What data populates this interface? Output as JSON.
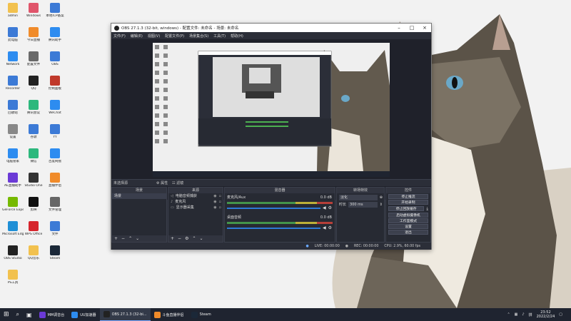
{
  "desktop": {
    "icons": [
      {
        "label": "admin",
        "color": "#f2c14e"
      },
      {
        "label": "Windows",
        "color": "#e0556b"
      },
      {
        "label": "本地ICP备案",
        "color": "#3c7ad6"
      },
      {
        "label": "此电脑",
        "color": "#3c7ad6"
      },
      {
        "label": "今日直播",
        "color": "#f08b2a"
      },
      {
        "label": "腾讯助手",
        "color": "#2d8cf0"
      },
      {
        "label": "Network",
        "color": "#2d8cf0"
      },
      {
        "label": "配置文件",
        "color": "#6a6a6a"
      },
      {
        "label": "OBS",
        "color": "#3c7ad6"
      },
      {
        "label": "Recorder",
        "color": "#3c7ad6"
      },
      {
        "label": "QQ",
        "color": "#222"
      },
      {
        "label": "控制面板",
        "color": "#c0392b"
      },
      {
        "label": "回收站",
        "color": "#3c7ad6"
      },
      {
        "label": "腾讯会议",
        "color": "#2db87d"
      },
      {
        "label": "WeChat",
        "color": "#2d8cf0"
      },
      {
        "label": "设置",
        "color": "#888"
      },
      {
        "label": "谷歌",
        "color": "#3c7ad6"
      },
      {
        "label": "YY",
        "color": "#3c7ad6"
      },
      {
        "label": "电脑管家",
        "color": "#2d8cf0"
      },
      {
        "label": "微信",
        "color": "#2db87d"
      },
      {
        "label": "百度网盘",
        "color": "#2d8cf0"
      },
      {
        "label": "AE直播助手",
        "color": "#6b3ad6"
      },
      {
        "label": "Studio One",
        "color": "#333"
      },
      {
        "label": "直播伴侣",
        "color": "#f08b2a"
      },
      {
        "label": "GeForce Experience",
        "color": "#76b900"
      },
      {
        "label": "剪映",
        "color": "#111"
      },
      {
        "label": "文件管理",
        "color": "#666"
      },
      {
        "label": "Microsoft Edge",
        "color": "#1f8fd6"
      },
      {
        "label": "WPS Office",
        "color": "#d6252d"
      },
      {
        "label": "文件",
        "color": "#3c7ad6"
      },
      {
        "label": "OBS Studio",
        "color": "#222"
      },
      {
        "label": "QQ音乐",
        "color": "#f2c14e"
      },
      {
        "label": "Steam",
        "color": "#1b2838"
      },
      {
        "label": "PS工具",
        "color": "#f2c14e"
      }
    ]
  },
  "obs": {
    "title": "OBS 27.1.3 (32-bit, windows) - 配置文件: 未命名 - 场景: 未命名",
    "menu": [
      "文件(F)",
      "编辑(E)",
      "视图(V)",
      "配置文件(P)",
      "场景集合(S)",
      "工具(T)",
      "帮助(H)"
    ],
    "scene_bar_label": "未选择源",
    "scene_bar_tools": [
      "⚙ 属性",
      "☷ 滤镜"
    ],
    "docks": {
      "scenes": {
        "title": "场景",
        "items": [
          "场景"
        ]
      },
      "sources": {
        "title": "来源",
        "items": [
          "电脑音频捕获",
          "麦克风",
          "显示器采集"
        ]
      },
      "mixer": {
        "title": "混音器",
        "channels": [
          {
            "name": "麦克风/Aux",
            "db": "0.0 dB"
          },
          {
            "name": "桌面音频",
            "db": "0.0 dB"
          }
        ]
      },
      "transitions": {
        "title": "转场特效",
        "type": "淡化",
        "duration_label": "时长",
        "duration": "300 ms"
      },
      "controls": {
        "title": "控件",
        "buttons": [
          "停止推流",
          "开始录制",
          "停止回放缓存",
          "启动虚拟摄像机",
          "工作室模式",
          "设置",
          "退出"
        ]
      }
    },
    "status": {
      "live": "LIVE: 00:00:00",
      "rec": "REC: 00:00:00",
      "cpu": "CPU: 2.9%, 60.00 fps"
    }
  },
  "taskbar": {
    "apps": [
      {
        "label": "MM调音台",
        "color": "#6b3ad6",
        "active": false
      },
      {
        "label": "UU加速器",
        "color": "#2d8cf0",
        "active": false
      },
      {
        "label": "OBS 27.1.3 (32-bi...",
        "color": "#222",
        "active": true
      },
      {
        "label": "斗鱼直播伴侣",
        "color": "#f08b2a",
        "active": false
      },
      {
        "label": "Steam",
        "color": "#1b2838",
        "active": false
      }
    ],
    "time": "23:52",
    "date": "2022/2/24"
  }
}
